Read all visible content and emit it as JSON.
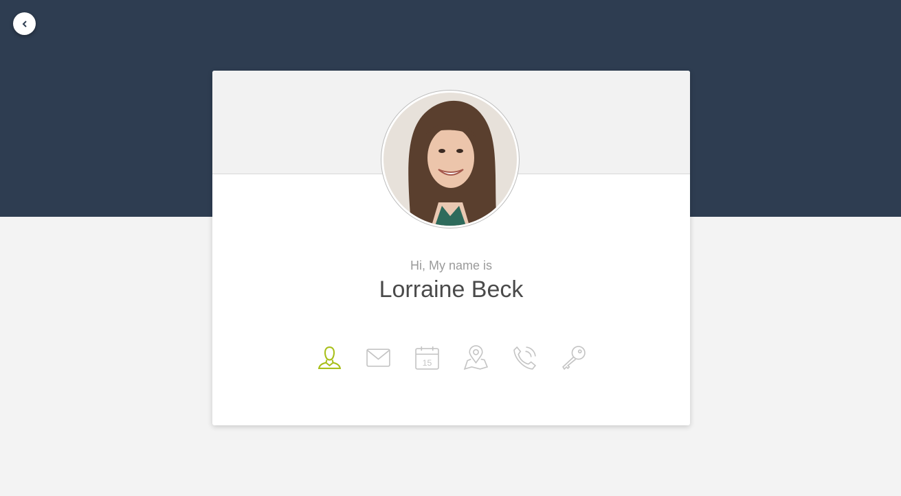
{
  "nav": {
    "back_icon": "chevron-left-icon"
  },
  "profile": {
    "greeting": "Hi, My name is",
    "name": "Lorraine Beck"
  },
  "info_icons": [
    {
      "name": "user-icon",
      "active": true
    },
    {
      "name": "mail-icon",
      "active": false
    },
    {
      "name": "calendar-icon",
      "active": false,
      "text": "15"
    },
    {
      "name": "map-pin-icon",
      "active": false
    },
    {
      "name": "phone-icon",
      "active": false
    },
    {
      "name": "key-icon",
      "active": false
    }
  ],
  "colors": {
    "header": "#2e3d51",
    "accent": "#a8bf1a",
    "icon": "#c4c4c4"
  }
}
